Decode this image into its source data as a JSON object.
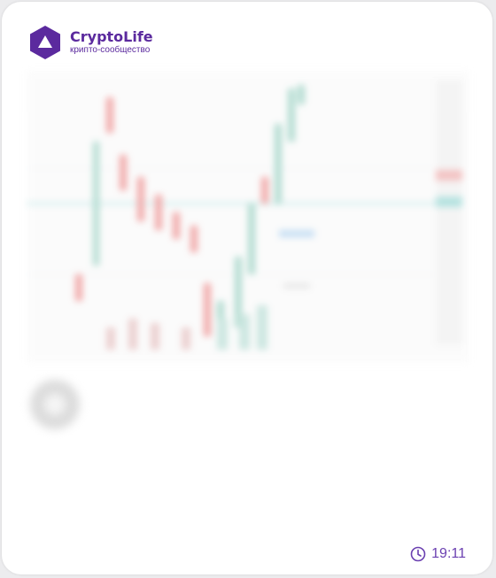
{
  "brand": {
    "name": "CryptoLife",
    "tagline": "крипто-сообщество"
  },
  "post": {
    "title": "",
    "meta": "",
    "lines": [
      {
        "label": "",
        "value": ""
      },
      {
        "label": "",
        "value": ""
      },
      {
        "label": "",
        "value": ""
      }
    ]
  },
  "footer": {
    "time": "19:11"
  },
  "icons": {
    "logo": "hexagon-logo-icon",
    "clock": "clock-icon"
  },
  "colors": {
    "brand": "#5b2a9e",
    "time": "#6a3fb0",
    "candle_up": "#26a69a",
    "candle_down": "#ef5350"
  }
}
